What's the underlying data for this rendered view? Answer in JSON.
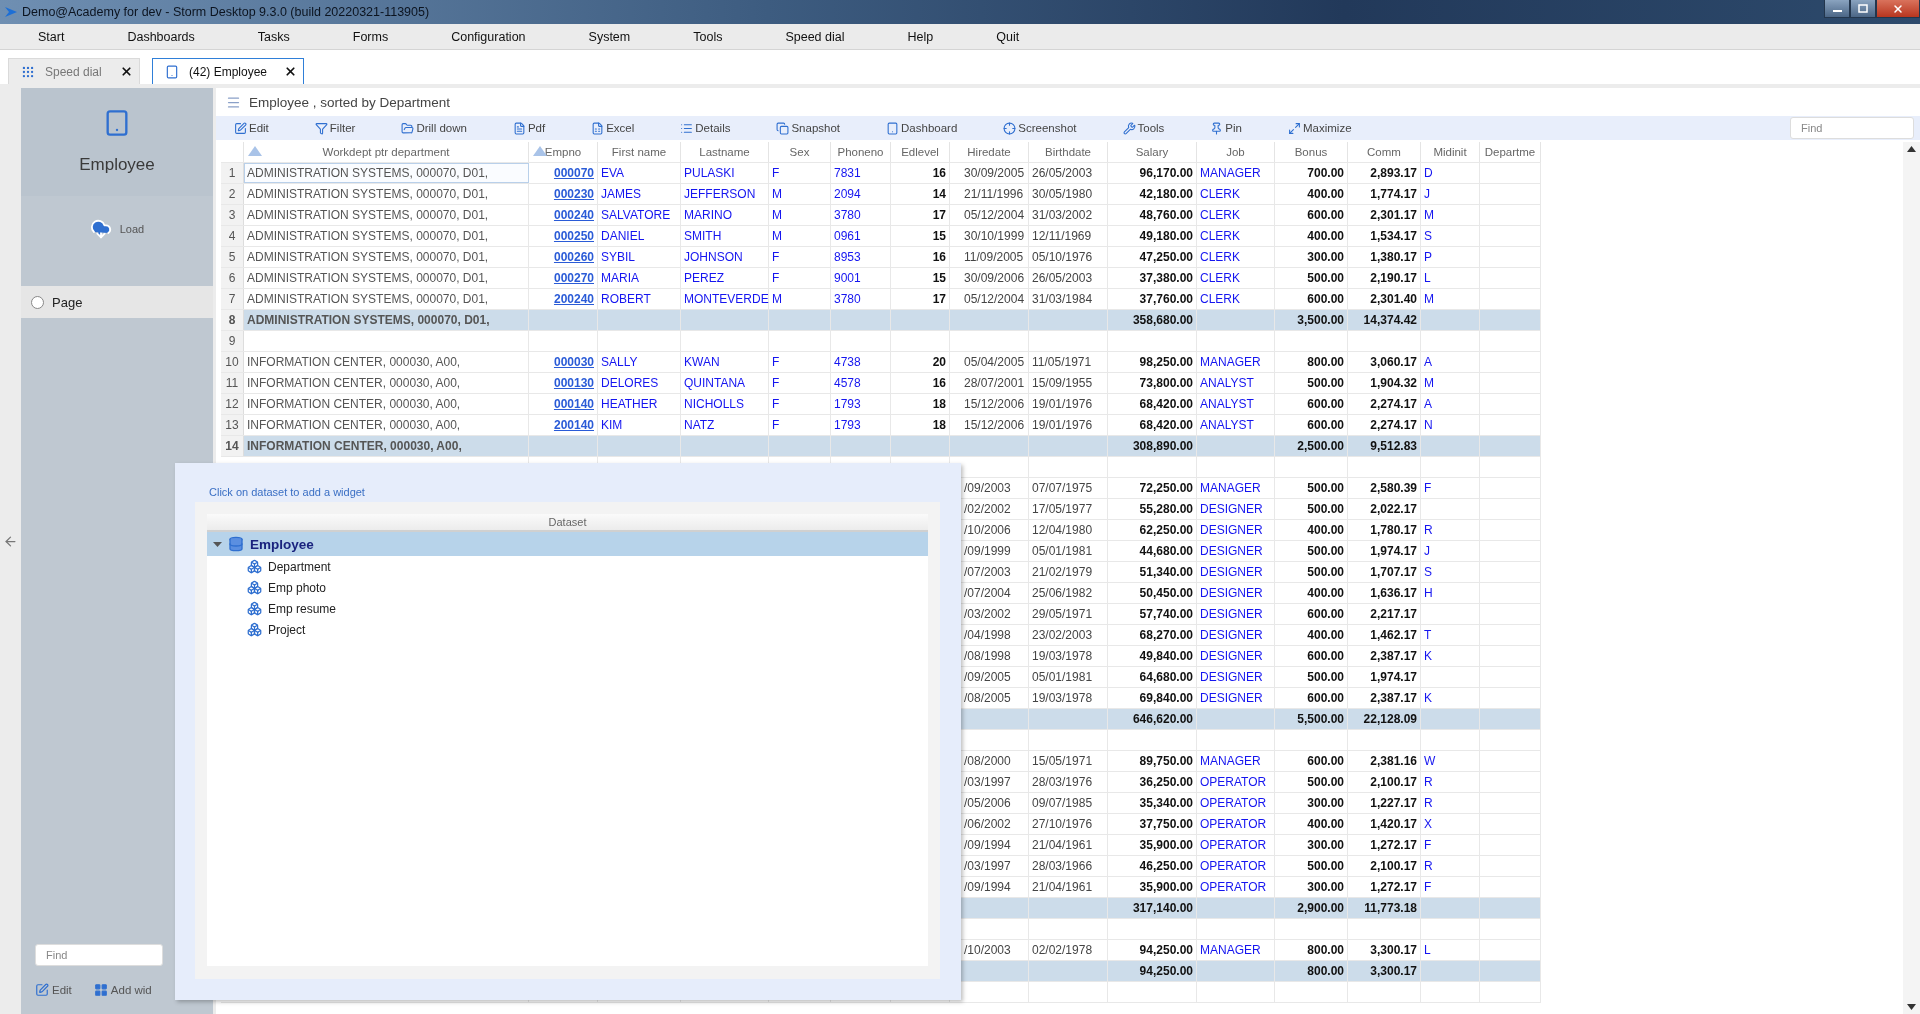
{
  "window": {
    "title": "Demo@Academy for dev -  Storm Desktop 9.3.0 (build 20220321-113905)"
  },
  "menu": [
    "Start",
    "Dashboards",
    "Tasks",
    "Forms",
    "Configuration",
    "System",
    "Tools",
    "Speed dial",
    "Help",
    "Quit"
  ],
  "tabs": [
    {
      "label": "Speed dial",
      "selected": false
    },
    {
      "label": "(42) Employee",
      "selected": true
    }
  ],
  "left_panel": {
    "title": "Employee",
    "load": "Load",
    "pages": [
      {
        "label": "Page",
        "checked": false
      }
    ],
    "find_placeholder": "Find",
    "footer": [
      "Edit",
      "Add wid"
    ]
  },
  "view": {
    "title": "Employee , sorted by Department",
    "toolbar": [
      "Edit",
      "Filter",
      "Drill down",
      "Pdf",
      "Excel",
      "Details",
      "Snapshot",
      "Dashboard",
      "Screenshot",
      "Tools",
      "Pin",
      "Maximize"
    ],
    "find_placeholder": "Find"
  },
  "table": {
    "columns": [
      {
        "label": "Workdept ptr department",
        "sorted": true
      },
      {
        "label": "Empno",
        "sorted": true
      },
      {
        "label": "First name",
        "sorted": false
      },
      {
        "label": "Lastname",
        "sorted": false
      },
      {
        "label": "Sex",
        "sorted": false
      },
      {
        "label": "Phoneno",
        "sorted": false
      },
      {
        "label": "Edlevel",
        "sorted": false
      },
      {
        "label": "Hiredate",
        "sorted": false
      },
      {
        "label": "Birthdate",
        "sorted": false
      },
      {
        "label": "Salary",
        "sorted": false
      },
      {
        "label": "Job",
        "sorted": false
      },
      {
        "label": "Bonus",
        "sorted": false
      },
      {
        "label": "Comm",
        "sorted": false
      },
      {
        "label": "Midinit",
        "sorted": false
      },
      {
        "label": "Departme",
        "sorted": false
      }
    ],
    "rows": [
      {
        "kind": "data",
        "num": "1",
        "selected": true,
        "cells": [
          "ADMINISTRATION SYSTEMS, 000070, D01,",
          "000070",
          "EVA",
          "PULASKI",
          "F",
          "7831",
          "16",
          "30/09/2005",
          "26/05/2003",
          "96,170.00",
          "MANAGER",
          "700.00",
          "2,893.17",
          "D"
        ]
      },
      {
        "kind": "data",
        "num": "2",
        "selected": false,
        "cells": [
          "ADMINISTRATION SYSTEMS, 000070, D01,",
          "000230",
          "JAMES",
          "JEFFERSON",
          "M",
          "2094",
          "14",
          "21/11/1996",
          "30/05/1980",
          "42,180.00",
          "CLERK",
          "400.00",
          "1,774.17",
          "J"
        ]
      },
      {
        "kind": "data",
        "num": "3",
        "selected": false,
        "cells": [
          "ADMINISTRATION SYSTEMS, 000070, D01,",
          "000240",
          "SALVATORE",
          "MARINO",
          "M",
          "3780",
          "17",
          "05/12/2004",
          "31/03/2002",
          "48,760.00",
          "CLERK",
          "600.00",
          "2,301.17",
          "M"
        ]
      },
      {
        "kind": "data",
        "num": "4",
        "selected": false,
        "cells": [
          "ADMINISTRATION SYSTEMS, 000070, D01,",
          "000250",
          "DANIEL",
          "SMITH",
          "M",
          "0961",
          "15",
          "30/10/1999",
          "12/11/1969",
          "49,180.00",
          "CLERK",
          "400.00",
          "1,534.17",
          "S"
        ]
      },
      {
        "kind": "data",
        "num": "5",
        "selected": false,
        "cells": [
          "ADMINISTRATION SYSTEMS, 000070, D01,",
          "000260",
          "SYBIL",
          "JOHNSON",
          "F",
          "8953",
          "16",
          "11/09/2005",
          "05/10/1976",
          "47,250.00",
          "CLERK",
          "300.00",
          "1,380.17",
          "P"
        ]
      },
      {
        "kind": "data",
        "num": "6",
        "selected": false,
        "cells": [
          "ADMINISTRATION SYSTEMS, 000070, D01,",
          "000270",
          "MARIA",
          "PEREZ",
          "F",
          "9001",
          "15",
          "30/09/2006",
          "26/05/2003",
          "37,380.00",
          "CLERK",
          "500.00",
          "2,190.17",
          "L"
        ]
      },
      {
        "kind": "data",
        "num": "7",
        "selected": false,
        "cells": [
          "ADMINISTRATION SYSTEMS, 000070, D01,",
          "200240",
          "ROBERT",
          "MONTEVERDE",
          "M",
          "3780",
          "17",
          "05/12/2004",
          "31/03/1984",
          "37,760.00",
          "CLERK",
          "600.00",
          "2,301.40",
          "M"
        ]
      },
      {
        "kind": "total",
        "num": "8",
        "selected": false,
        "cells": [
          "ADMINISTRATION SYSTEMS, 000070, D01,",
          null,
          null,
          null,
          null,
          null,
          null,
          null,
          null,
          "358,680.00",
          null,
          "3,500.00",
          "14,374.42",
          null
        ]
      },
      {
        "kind": "blank",
        "num": "9",
        "selected": false,
        "cells": []
      },
      {
        "kind": "data",
        "num": "10",
        "selected": false,
        "cells": [
          "INFORMATION CENTER, 000030, A00,",
          "000030",
          "SALLY",
          "KWAN",
          "F",
          "4738",
          "20",
          "05/04/2005",
          "11/05/1971",
          "98,250.00",
          "MANAGER",
          "800.00",
          "3,060.17",
          "A"
        ]
      },
      {
        "kind": "data",
        "num": "11",
        "selected": false,
        "cells": [
          "INFORMATION CENTER, 000030, A00,",
          "000130",
          "DELORES",
          "QUINTANA",
          "F",
          "4578",
          "16",
          "28/07/2001",
          "15/09/1955",
          "73,800.00",
          "ANALYST",
          "500.00",
          "1,904.32",
          "M"
        ]
      },
      {
        "kind": "data",
        "num": "12",
        "selected": false,
        "cells": [
          "INFORMATION CENTER, 000030, A00,",
          "000140",
          "HEATHER",
          "NICHOLLS",
          "F",
          "1793",
          "18",
          "15/12/2006",
          "19/01/1976",
          "68,420.00",
          "ANALYST",
          "600.00",
          "2,274.17",
          "A"
        ]
      },
      {
        "kind": "data",
        "num": "13",
        "selected": false,
        "cells": [
          "INFORMATION CENTER, 000030, A00,",
          "200140",
          "KIM",
          "NATZ",
          "F",
          "1793",
          "18",
          "15/12/2006",
          "19/01/1976",
          "68,420.00",
          "ANALYST",
          "600.00",
          "2,274.17",
          "N"
        ]
      },
      {
        "kind": "total",
        "num": "14",
        "selected": false,
        "cells": [
          "INFORMATION CENTER, 000030, A00,",
          null,
          null,
          null,
          null,
          null,
          null,
          null,
          null,
          "308,890.00",
          null,
          "2,500.00",
          "9,512.83",
          null
        ]
      },
      {
        "kind": "blank",
        "cells": []
      },
      {
        "kind": "data",
        "cells": [
          null,
          null,
          null,
          null,
          null,
          null,
          null,
          "/09/2003",
          "07/07/1975",
          "72,250.00",
          "MANAGER",
          "500.00",
          "2,580.39",
          "F"
        ]
      },
      {
        "kind": "data",
        "cells": [
          null,
          null,
          null,
          null,
          null,
          null,
          null,
          "/02/2002",
          "17/05/1977",
          "55,280.00",
          "DESIGNER",
          "500.00",
          "2,022.17",
          null
        ]
      },
      {
        "kind": "data",
        "cells": [
          null,
          null,
          null,
          null,
          null,
          null,
          null,
          "/10/2006",
          "12/04/1980",
          "62,250.00",
          "DESIGNER",
          "400.00",
          "1,780.17",
          "R"
        ]
      },
      {
        "kind": "data",
        "cells": [
          null,
          null,
          null,
          null,
          null,
          null,
          null,
          "/09/1999",
          "05/01/1981",
          "44,680.00",
          "DESIGNER",
          "500.00",
          "1,974.17",
          "J"
        ]
      },
      {
        "kind": "data",
        "cells": [
          null,
          null,
          null,
          null,
          null,
          null,
          null,
          "/07/2003",
          "21/02/1979",
          "51,340.00",
          "DESIGNER",
          "500.00",
          "1,707.17",
          "S"
        ]
      },
      {
        "kind": "data",
        "cells": [
          null,
          null,
          null,
          null,
          null,
          null,
          null,
          "/07/2004",
          "25/06/1982",
          "50,450.00",
          "DESIGNER",
          "400.00",
          "1,636.17",
          "H"
        ]
      },
      {
        "kind": "data",
        "cells": [
          null,
          null,
          null,
          null,
          null,
          null,
          null,
          "/03/2002",
          "29/05/1971",
          "57,740.00",
          "DESIGNER",
          "600.00",
          "2,217.17",
          null
        ]
      },
      {
        "kind": "data",
        "cells": [
          null,
          null,
          null,
          null,
          null,
          null,
          null,
          "/04/1998",
          "23/02/2003",
          "68,270.00",
          "DESIGNER",
          "400.00",
          "1,462.17",
          "T"
        ]
      },
      {
        "kind": "data",
        "cells": [
          null,
          null,
          null,
          null,
          null,
          null,
          null,
          "/08/1998",
          "19/03/1978",
          "49,840.00",
          "DESIGNER",
          "600.00",
          "2,387.17",
          "K"
        ]
      },
      {
        "kind": "data",
        "cells": [
          null,
          null,
          null,
          null,
          null,
          null,
          null,
          "/09/2005",
          "05/01/1981",
          "64,680.00",
          "DESIGNER",
          "500.00",
          "1,974.17",
          null
        ]
      },
      {
        "kind": "data",
        "cells": [
          null,
          null,
          null,
          null,
          null,
          null,
          null,
          "/08/2005",
          "19/03/1978",
          "69,840.00",
          "DESIGNER",
          "600.00",
          "2,387.17",
          "K"
        ]
      },
      {
        "kind": "total",
        "cells": [
          null,
          null,
          null,
          null,
          null,
          null,
          null,
          null,
          null,
          "646,620.00",
          null,
          "5,500.00",
          "22,128.09",
          null
        ]
      },
      {
        "kind": "blank",
        "cells": []
      },
      {
        "kind": "data",
        "cells": [
          null,
          null,
          null,
          null,
          null,
          null,
          null,
          "/08/2000",
          "15/05/1971",
          "89,750.00",
          "MANAGER",
          "600.00",
          "2,381.16",
          "W"
        ]
      },
      {
        "kind": "data",
        "cells": [
          null,
          null,
          null,
          null,
          null,
          null,
          null,
          "/03/1997",
          "28/03/1976",
          "36,250.00",
          "OPERATOR",
          "500.00",
          "2,100.17",
          "R"
        ]
      },
      {
        "kind": "data",
        "cells": [
          null,
          null,
          null,
          null,
          null,
          null,
          null,
          "/05/2006",
          "09/07/1985",
          "35,340.00",
          "OPERATOR",
          "300.00",
          "1,227.17",
          "R"
        ]
      },
      {
        "kind": "data",
        "cells": [
          null,
          null,
          null,
          null,
          null,
          null,
          null,
          "/06/2002",
          "27/10/1976",
          "37,750.00",
          "OPERATOR",
          "400.00",
          "1,420.17",
          "X"
        ]
      },
      {
        "kind": "data",
        "cells": [
          null,
          null,
          null,
          null,
          null,
          null,
          null,
          "/09/1994",
          "21/04/1961",
          "35,900.00",
          "OPERATOR",
          "300.00",
          "1,272.17",
          "F"
        ]
      },
      {
        "kind": "data",
        "cells": [
          null,
          null,
          null,
          null,
          null,
          null,
          null,
          "/03/1997",
          "28/03/1966",
          "46,250.00",
          "OPERATOR",
          "500.00",
          "2,100.17",
          "R"
        ]
      },
      {
        "kind": "data",
        "cells": [
          null,
          null,
          null,
          null,
          null,
          null,
          null,
          "/09/1994",
          "21/04/1961",
          "35,900.00",
          "OPERATOR",
          "300.00",
          "1,272.17",
          "F"
        ]
      },
      {
        "kind": "total",
        "cells": [
          null,
          null,
          null,
          null,
          null,
          null,
          null,
          null,
          null,
          "317,140.00",
          null,
          "2,900.00",
          "11,773.18",
          null
        ]
      },
      {
        "kind": "blank",
        "cells": []
      },
      {
        "kind": "data",
        "cells": [
          null,
          null,
          null,
          null,
          null,
          null,
          null,
          "/10/2003",
          "02/02/1978",
          "94,250.00",
          "MANAGER",
          "800.00",
          "3,300.17",
          "L"
        ]
      },
      {
        "kind": "total",
        "cells": [
          null,
          null,
          null,
          null,
          null,
          null,
          null,
          null,
          null,
          "94,250.00",
          null,
          "800.00",
          "3,300.17",
          null
        ]
      },
      {
        "kind": "blank",
        "cells": []
      }
    ]
  },
  "dataset_panel": {
    "hint": "Click on dataset to add a widget",
    "header": "Dataset",
    "tree": [
      {
        "label": "Employee",
        "expanded": true,
        "selected": true,
        "children": [
          {
            "label": "Department",
            "selected": false
          },
          {
            "label": "Emp photo",
            "selected": false
          },
          {
            "label": "Emp resume",
            "selected": false
          },
          {
            "label": "Project",
            "selected": false
          }
        ]
      }
    ]
  }
}
